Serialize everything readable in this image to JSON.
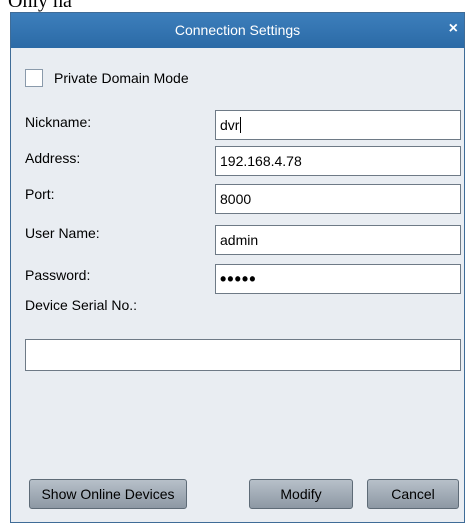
{
  "top_text": "Only ha",
  "dialog": {
    "title": "Connection Settings",
    "close_glyph": "×",
    "private_domain_label": "Private Domain Mode",
    "private_domain_checked": false,
    "fields": {
      "nickname": {
        "label": "Nickname:",
        "value": "dvr"
      },
      "address": {
        "label": "Address:",
        "value": "192.168.4.78"
      },
      "port": {
        "label": "Port:",
        "value": "8000"
      },
      "username": {
        "label": "User Name:",
        "value": "admin"
      },
      "password": {
        "label": "Password:",
        "value": "•••••"
      },
      "serial": {
        "label": "Device Serial No.:",
        "value": ""
      }
    },
    "buttons": {
      "show_online": "Show Online Devices",
      "modify": "Modify",
      "cancel": "Cancel"
    }
  },
  "colors": {
    "titlebar": "#2f6fa9",
    "dialog_bg": "#e9edf2",
    "button": "#a5afb9"
  }
}
